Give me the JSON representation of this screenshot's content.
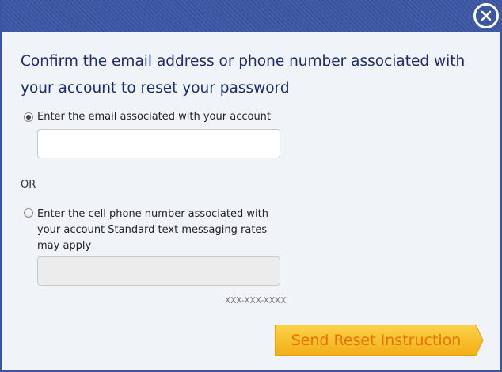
{
  "dialog": {
    "title": "Confirm the email address or phone number associated with your account to reset your password",
    "close_icon": "close-icon"
  },
  "email_option": {
    "label": "Enter the email associated with your account",
    "selected": true,
    "value": ""
  },
  "separator": "OR",
  "phone_option": {
    "label": "Enter the cell phone number associated with your account Standard text messaging rates may apply",
    "selected": false,
    "value": "",
    "format_hint": "XXX-XXX-XXXX"
  },
  "submit": {
    "label": "Send Reset Instruction"
  },
  "colors": {
    "header": "#3c56a4",
    "title": "#1a2c6b",
    "button_fill": "#f6b724",
    "button_text": "#e8710a",
    "background": "#f0f4f9"
  }
}
